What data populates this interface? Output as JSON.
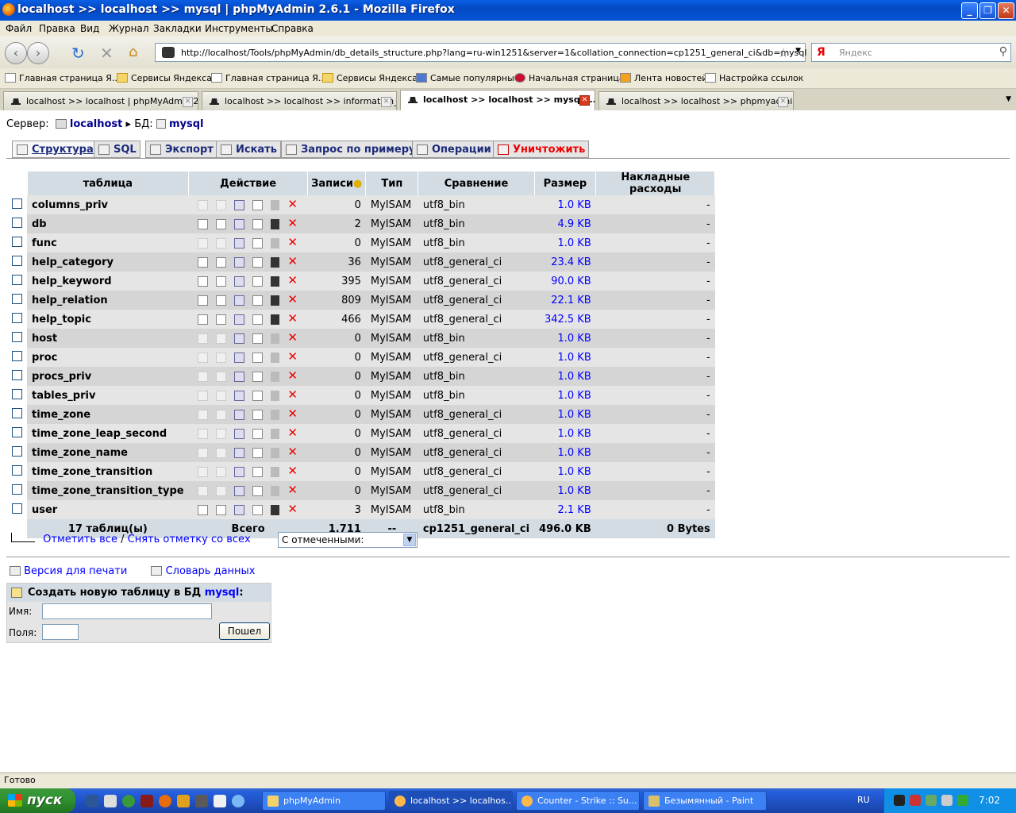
{
  "window": {
    "title": "localhost >> localhost >> mysql | phpMyAdmin 2.6.1 - Mozilla Firefox"
  },
  "menu": [
    "Файл",
    "Правка",
    "Вид",
    "Журнал",
    "Закладки",
    "Инструменты",
    "Справка"
  ],
  "address": {
    "url": "http://localhost/Tools/phpMyAdmin/db_details_structure.php?lang=ru-win1251&server=1&collation_connection=cp1251_general_ci&db=mysql"
  },
  "search": {
    "placeholder": "Яндекс"
  },
  "bookmarks": [
    "Главная страница Я...",
    "Сервисы Яндекса",
    "Главная страница Я...",
    "Сервисы Яндекса",
    "Самые популярные",
    "Начальная страница",
    "Лента новостей",
    "Настройка ссылок"
  ],
  "tabs": [
    {
      "label": "localhost >> localhost | phpMyAdmin 2..."
    },
    {
      "label": "localhost >> localhost >> information_..."
    },
    {
      "label": "localhost >> localhost >> mysql ..."
    },
    {
      "label": "localhost >> localhost >> phpmyadmin..."
    }
  ],
  "breadcrumb": {
    "server_label": "Сервер:",
    "server": "localhost",
    "db_label": "БД:",
    "db": "mysql"
  },
  "page_tabs": [
    "Структура",
    "SQL",
    "Экспорт",
    "Искать",
    "Запрос по примеру",
    "Операции",
    "Уничтожить"
  ],
  "table_headers": {
    "table": "таблица",
    "action": "Действие",
    "records": "Записи",
    "type": "Тип",
    "collation": "Сравнение",
    "size": "Размер",
    "overhead": "Накладные расходы"
  },
  "rows": [
    {
      "name": "columns_priv",
      "records": "0",
      "type": "MyISAM",
      "collation": "utf8_bin",
      "size": "1.0 KB",
      "overhead": "-",
      "empty": true
    },
    {
      "name": "db",
      "records": "2",
      "type": "MyISAM",
      "collation": "utf8_bin",
      "size": "4.9 KB",
      "overhead": "-",
      "empty": false
    },
    {
      "name": "func",
      "records": "0",
      "type": "MyISAM",
      "collation": "utf8_bin",
      "size": "1.0 KB",
      "overhead": "-",
      "empty": true
    },
    {
      "name": "help_category",
      "records": "36",
      "type": "MyISAM",
      "collation": "utf8_general_ci",
      "size": "23.4 KB",
      "overhead": "-",
      "empty": false
    },
    {
      "name": "help_keyword",
      "records": "395",
      "type": "MyISAM",
      "collation": "utf8_general_ci",
      "size": "90.0 KB",
      "overhead": "-",
      "empty": false
    },
    {
      "name": "help_relation",
      "records": "809",
      "type": "MyISAM",
      "collation": "utf8_general_ci",
      "size": "22.1 KB",
      "overhead": "-",
      "empty": false
    },
    {
      "name": "help_topic",
      "records": "466",
      "type": "MyISAM",
      "collation": "utf8_general_ci",
      "size": "342.5 KB",
      "overhead": "-",
      "empty": false
    },
    {
      "name": "host",
      "records": "0",
      "type": "MyISAM",
      "collation": "utf8_bin",
      "size": "1.0 KB",
      "overhead": "-",
      "empty": true
    },
    {
      "name": "proc",
      "records": "0",
      "type": "MyISAM",
      "collation": "utf8_general_ci",
      "size": "1.0 KB",
      "overhead": "-",
      "empty": true
    },
    {
      "name": "procs_priv",
      "records": "0",
      "type": "MyISAM",
      "collation": "utf8_bin",
      "size": "1.0 KB",
      "overhead": "-",
      "empty": true
    },
    {
      "name": "tables_priv",
      "records": "0",
      "type": "MyISAM",
      "collation": "utf8_bin",
      "size": "1.0 KB",
      "overhead": "-",
      "empty": true
    },
    {
      "name": "time_zone",
      "records": "0",
      "type": "MyISAM",
      "collation": "utf8_general_ci",
      "size": "1.0 KB",
      "overhead": "-",
      "empty": true
    },
    {
      "name": "time_zone_leap_second",
      "records": "0",
      "type": "MyISAM",
      "collation": "utf8_general_ci",
      "size": "1.0 KB",
      "overhead": "-",
      "empty": true
    },
    {
      "name": "time_zone_name",
      "records": "0",
      "type": "MyISAM",
      "collation": "utf8_general_ci",
      "size": "1.0 KB",
      "overhead": "-",
      "empty": true
    },
    {
      "name": "time_zone_transition",
      "records": "0",
      "type": "MyISAM",
      "collation": "utf8_general_ci",
      "size": "1.0 KB",
      "overhead": "-",
      "empty": true
    },
    {
      "name": "time_zone_transition_type",
      "records": "0",
      "type": "MyISAM",
      "collation": "utf8_general_ci",
      "size": "1.0 KB",
      "overhead": "-",
      "empty": true
    },
    {
      "name": "user",
      "records": "3",
      "type": "MyISAM",
      "collation": "utf8_bin",
      "size": "2.1 KB",
      "overhead": "-",
      "empty": false
    }
  ],
  "totals": {
    "tables": "17 таблиц(ы)",
    "label": "Всего",
    "records": "1,711",
    "type": "--",
    "collation": "cp1251_general_ci",
    "size": "496.0 KB",
    "overhead": "0 Bytes"
  },
  "selection": {
    "check_all": "Отметить все",
    "separator": "/",
    "uncheck_all": "Снять отметку со всех",
    "with_selected": "С отмеченными:"
  },
  "links": {
    "print": "Версия для печати",
    "dictionary": "Словарь данных"
  },
  "create_table": {
    "title_prefix": "Создать новую таблицу в БД",
    "db": "mysql",
    "title_suffix": ":",
    "name_label": "Имя:",
    "fields_label": "Поля:",
    "go": "Пошел"
  },
  "status": {
    "text": "Готово"
  },
  "taskbar": {
    "start": "пуск",
    "tasks": [
      "phpMyAdmin",
      "localhost >> localhos...",
      "Counter - Strike :: Su...",
      "Безымянный - Paint"
    ],
    "lang": "RU",
    "time": "7:02"
  }
}
